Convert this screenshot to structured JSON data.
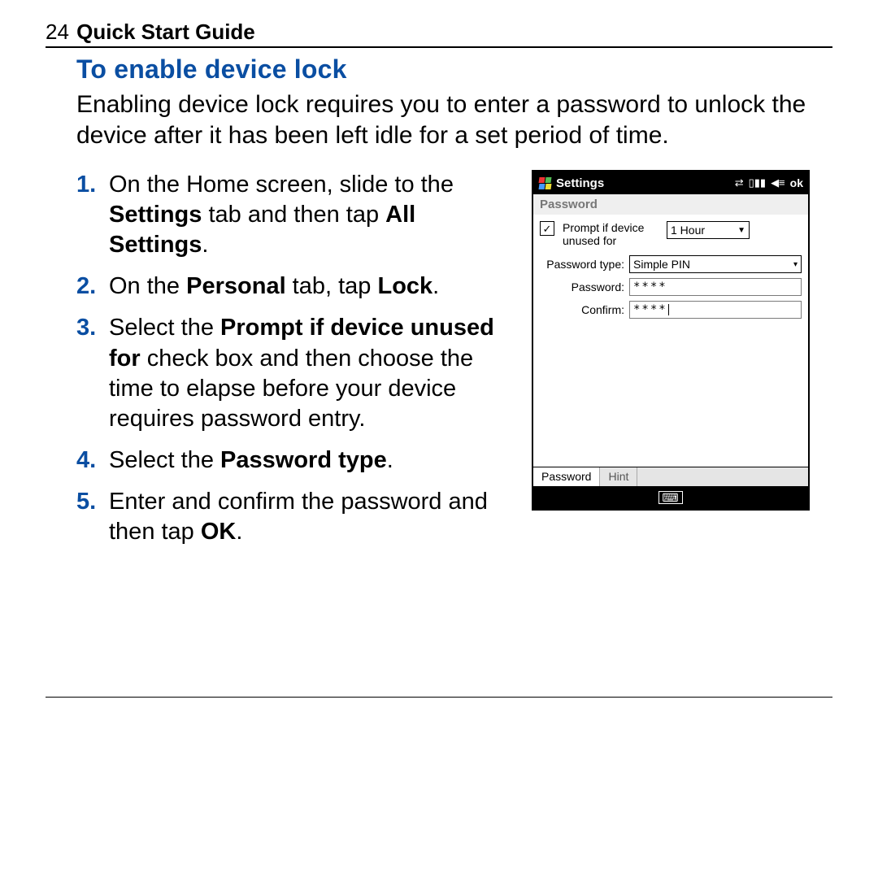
{
  "page": {
    "number": "24",
    "title": "Quick Start Guide"
  },
  "section": {
    "heading": "To enable device lock",
    "intro": "Enabling device lock requires you to enter a password to unlock the device after it has been left idle for a set period of time."
  },
  "steps": {
    "s1a": "On the Home screen, slide to the ",
    "s1b": "Settings",
    "s1c": " tab and then tap ",
    "s1d": "All Settings",
    "s1e": ".",
    "s2a": "On the ",
    "s2b": "Personal",
    "s2c": " tab, tap ",
    "s2d": "Lock",
    "s2e": ".",
    "s3a": "Select the ",
    "s3b": "Prompt if device unused for",
    "s3c": " check box and then choose the time to elapse before your device requires password entry.",
    "s4a": "Select the ",
    "s4b": "Password type",
    "s4c": ".",
    "s5a": "Enter and confirm the password and then tap ",
    "s5b": "OK",
    "s5c": "."
  },
  "device": {
    "title": "Settings",
    "ok": "ok",
    "subhead": "Password",
    "prompt_checked": true,
    "prompt_label_line1": "Prompt if device",
    "prompt_label_line2": "unused for",
    "time_value": "1 Hour",
    "pwtype_label": "Password type:",
    "pwtype_value": "Simple PIN",
    "pw_label": "Password:",
    "pw_value": "****",
    "confirm_label": "Confirm:",
    "confirm_value": "****",
    "tab_password": "Password",
    "tab_hint": "Hint"
  }
}
